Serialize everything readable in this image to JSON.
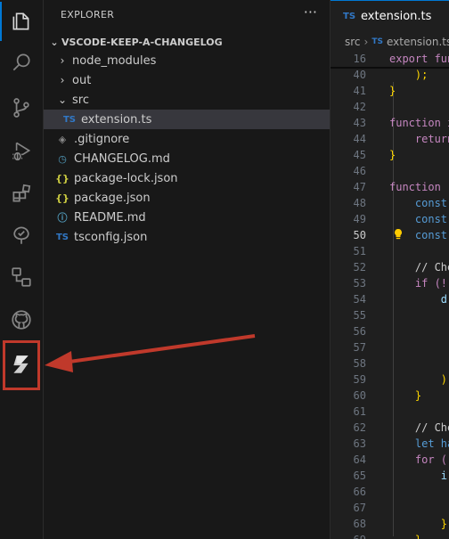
{
  "activity_bar": {
    "items": [
      {
        "icon": "explorer-icon"
      },
      {
        "icon": "search-icon"
      },
      {
        "icon": "source-control-icon"
      },
      {
        "icon": "run-debug-icon"
      },
      {
        "icon": "extensions-icon"
      },
      {
        "icon": "testing-icon"
      },
      {
        "icon": "remote-explorer-icon"
      },
      {
        "icon": "github-icon"
      },
      {
        "icon": "keep-a-changelog-icon"
      }
    ]
  },
  "sidebar": {
    "title": "EXPLORER",
    "more": "···",
    "folder": "VSCODE-KEEP-A-CHANGELOG",
    "items": [
      {
        "label": "node_modules",
        "twist": "›",
        "icon": ""
      },
      {
        "label": "out",
        "twist": "›",
        "icon": ""
      },
      {
        "label": "src",
        "twist": "⌄",
        "icon": ""
      },
      {
        "label": "extension.ts",
        "twist": "",
        "icon": "TS"
      },
      {
        "label": ".gitignore",
        "twist": "",
        "icon": "◈"
      },
      {
        "label": "CHANGELOG.md",
        "twist": "",
        "icon": "◷"
      },
      {
        "label": "package-lock.json",
        "twist": "",
        "icon": "{}"
      },
      {
        "label": "package.json",
        "twist": "",
        "icon": "{}"
      },
      {
        "label": "README.md",
        "twist": "",
        "icon": "ⓘ"
      },
      {
        "label": "tsconfig.json",
        "twist": "",
        "icon": "TS"
      }
    ]
  },
  "editor": {
    "tab": {
      "icon": "TS",
      "label": "extension.ts"
    },
    "breadcrumb": {
      "folder": "src",
      "sep": "›",
      "icon": "TS",
      "file": "extension.ts"
    },
    "lines": [
      {
        "n": "16",
        "text": "export function"
      },
      {
        "n": "40",
        "text": "    );"
      },
      {
        "n": "41",
        "text": "}"
      },
      {
        "n": "42",
        "text": ""
      },
      {
        "n": "43",
        "text": "function i"
      },
      {
        "n": "44",
        "text": "    return"
      },
      {
        "n": "45",
        "text": "}"
      },
      {
        "n": "46",
        "text": ""
      },
      {
        "n": "47",
        "text": "function "
      },
      {
        "n": "48",
        "text": "    const"
      },
      {
        "n": "49",
        "text": "    const"
      },
      {
        "n": "50",
        "text": "    const"
      },
      {
        "n": "51",
        "text": ""
      },
      {
        "n": "52",
        "text": "    // Che"
      },
      {
        "n": "53",
        "text": "    if (!"
      },
      {
        "n": "54",
        "text": "        d"
      },
      {
        "n": "55",
        "text": ""
      },
      {
        "n": "56",
        "text": ""
      },
      {
        "n": "57",
        "text": ""
      },
      {
        "n": "58",
        "text": ""
      },
      {
        "n": "59",
        "text": "        )"
      },
      {
        "n": "60",
        "text": "    }"
      },
      {
        "n": "61",
        "text": ""
      },
      {
        "n": "62",
        "text": "    // Che"
      },
      {
        "n": "63",
        "text": "    let ha"
      },
      {
        "n": "64",
        "text": "    for ("
      },
      {
        "n": "65",
        "text": "        i"
      },
      {
        "n": "66",
        "text": ""
      },
      {
        "n": "67",
        "text": ""
      },
      {
        "n": "68",
        "text": "        }"
      },
      {
        "n": "69",
        "text": "    }"
      }
    ]
  },
  "colors": {
    "annotation": "#c0392b",
    "accent": "#0078d4",
    "ts": "#3178c6",
    "json": "#cbcb41"
  }
}
